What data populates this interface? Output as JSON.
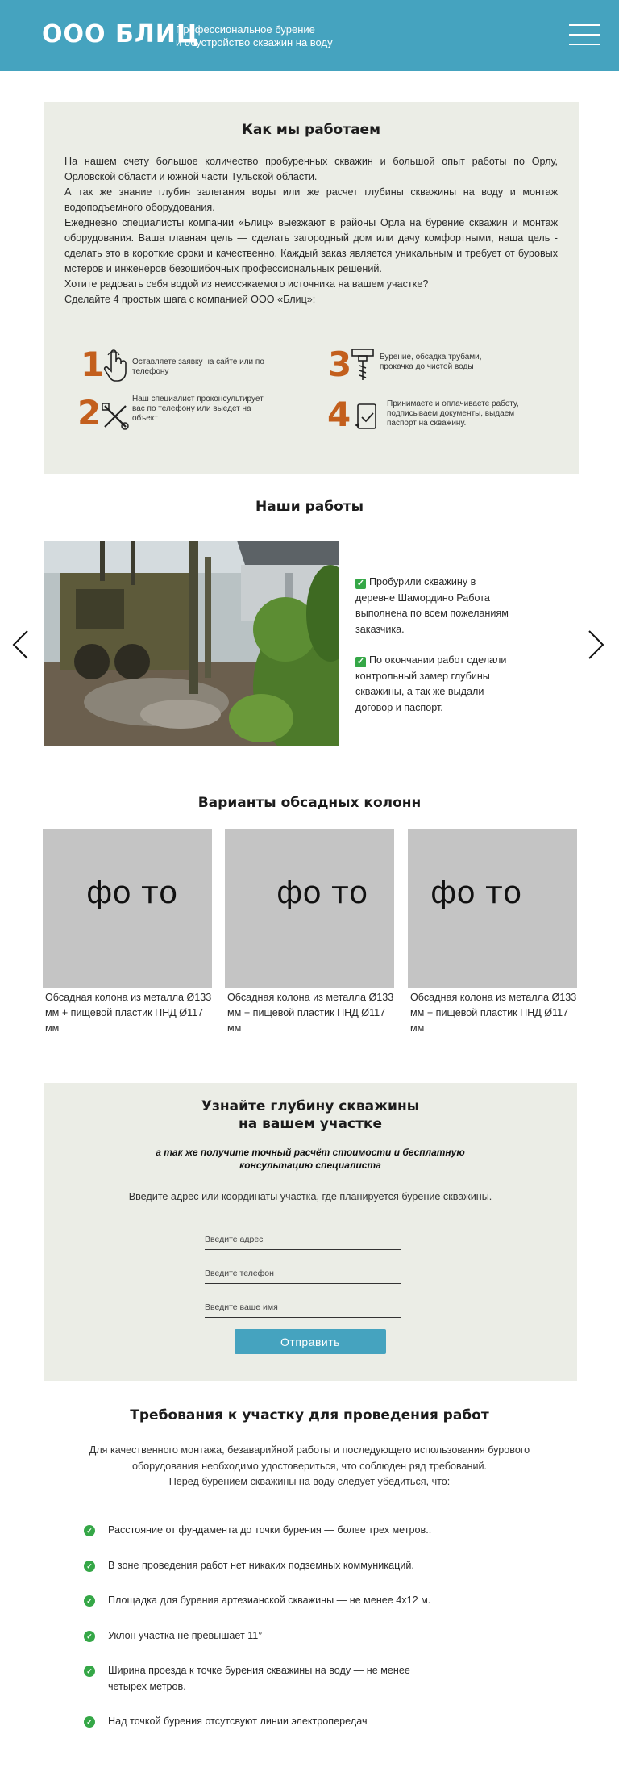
{
  "header": {
    "logo": "ООО БЛИЦ",
    "tagline_line1": "Профессиональное бурение",
    "tagline_line2": "и обустройство скважин на воду",
    "bg_color": "#45a3bf"
  },
  "how": {
    "title": "Как мы работаем",
    "paragraphs": [
      "На нашем счету большое количество пробуренных скважин и большой опыт работы по Орлу, Орловской области и южной части Тульской области.",
      "А так же знание глубин залегания воды или же расчет глубины скважины на воду и монтаж водоподъемного оборудования.",
      "Ежедневно специалисты компании «Блиц» выезжают в районы Орла на бурение скважин и монтаж оборудования. Ваша главная цель — сделать загородный дом или дачу комфортными, наша цель - сделать это в короткие сроки и качественно. Каждый заказ является уникальным и требует от буровых мстеров и инженеров безошибочных профессиональных решений.",
      "Хотите радовать себя водой из неиссякаемого источника на вашем участке?",
      "Сделайте 4 простых шага с  компанией ООО «Блиц»:"
    ],
    "steps": [
      {
        "num": "1",
        "icon": "hand-pointer-icon",
        "text": "Оставляете заявку на сайте или по телефону"
      },
      {
        "num": "2",
        "icon": "tools-icon",
        "text": "Наш специалист проконсультирует вас по телефону или выедет на объект"
      },
      {
        "num": "3",
        "icon": "drill-icon",
        "text": "Бурение, обсадка трубами, прокачка до чистой воды"
      },
      {
        "num": "4",
        "icon": "document-check-icon",
        "text": "Принимаете и оплачиваете работу, подписываем документы, выдаем паспорт на скважину."
      }
    ],
    "accent_color": "#c35f1d"
  },
  "works": {
    "title": "Наши работы",
    "items": [
      "Пробурили скважину в деревне Шамордино Работа выполнена по всем пожеланиям заказчика.",
      "По окончании работ сделали контрольный замер глубины скважины, а так же выдали договор и паспорт."
    ],
    "slides_total": 3,
    "active_slide": 1
  },
  "casing": {
    "title": "Варианты обсадных колонн",
    "photo_placeholder": "фо то",
    "cards": [
      {
        "caption": "Обсадная колона из металла Ø133 мм + пищевой пластик ПНД Ø117 мм"
      },
      {
        "caption": "Обсадная колона из металла Ø133 мм + пищевой пластик ПНД Ø117 мм"
      },
      {
        "caption": "Обсадная колона из металла Ø133 мм + пищевой пластик ПНД Ø117 мм"
      }
    ]
  },
  "depth_form": {
    "title_line1": "Узнайте глубину скважины",
    "title_line2": "на вашем участке",
    "subtitle_line1": "а так же получите точный расчёт стоимости и бесплатную",
    "subtitle_line2": "консультацию специалиста",
    "hint": "Введите адрес или координаты участка, где планируется бурение скважины.",
    "address_placeholder": "Введите адрес",
    "phone_placeholder": "Введите телефон",
    "name_placeholder": "Введите ваше имя",
    "submit_label": "Отправить"
  },
  "requirements": {
    "title": "Требования к участку  для проведения работ",
    "intro_line1": "Для качественного монтажа, безаварийной работы и последующего использования бурового",
    "intro_line2": "оборудования необходимо удостовериться, что соблюден ряд требований.",
    "intro_line3": "Перед бурением скважины на воду следует убедиться, что:",
    "items": [
      "Расстояние от фундамента до точки бурения — более трех метров..",
      "В зоне проведения работ нет никаких подземных коммуникаций.",
      "Площадка для бурения артезианской скважины — не менее 4х12 м.",
      "Уклон участка не превышает 11°",
      "Ширина проезда к точке бурения скважины на воду — не менее четырех метров.",
      "Над точкой бурения отсутсвуют линии электропередач"
    ],
    "check_color": "#35a747"
  }
}
